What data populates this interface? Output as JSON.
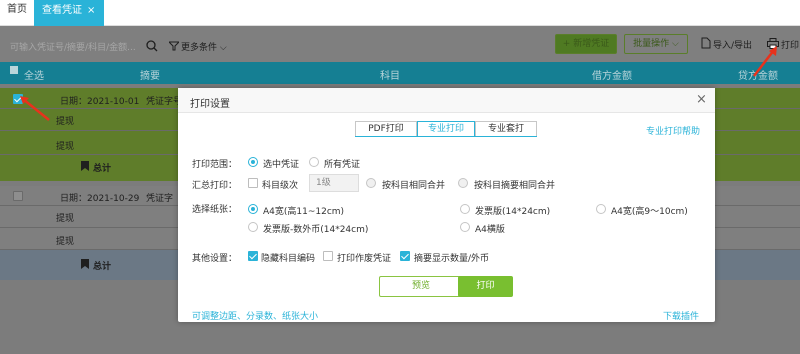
{
  "tabs": {
    "home": "首页",
    "active": "查看凭证",
    "active_close": "×"
  },
  "toolbar": {
    "search_placeholder": "可输入凭证号/摘要/科目/金额...",
    "more_conditions": "更多条件",
    "add_voucher": "+ 新增凭证",
    "batch_ops": "批量操作",
    "import_export": "导入/导出",
    "print": "打印"
  },
  "table": {
    "headers": {
      "select_all": "全选",
      "summary": "摘要",
      "subject": "科目",
      "debit": "借方金额",
      "credit": "贷方金额"
    },
    "groups": [
      {
        "date": "日期：2021-10-01",
        "voucher": "凭证字号",
        "rows": [
          "提现",
          "提现"
        ],
        "total": "总计",
        "selected": true
      },
      {
        "date": "日期：2021-10-29",
        "voucher": "凭证字",
        "rows": [
          "提现",
          "提现"
        ],
        "total": "总计",
        "selected": false
      }
    ]
  },
  "dialog": {
    "title": "打印设置",
    "close": "×",
    "tabs": [
      "PDF打印",
      "专业打印",
      "专业套打"
    ],
    "help_link": "专业打印帮助",
    "print_range": {
      "label": "打印范围：",
      "options": [
        "选中凭证",
        "所有凭证"
      ]
    },
    "summary_print": {
      "label": "汇总打印：",
      "subject_level": "科目级次",
      "level_value": "1级",
      "merge_subject": "按科目相同合并",
      "merge_subject_summary": "按科目摘要相同合并"
    },
    "paper": {
      "label": "选择纸张：",
      "options": [
        "A4宽(高11~12cm)",
        "发票版(14*24cm)",
        "A4宽(高9～10cm)",
        "发票版-数外币(14*24cm)",
        "A4横版"
      ]
    },
    "other": {
      "label": "其他设置：",
      "options": [
        "隐藏科目编码",
        "打印作废凭证",
        "摘要显示数量/外币"
      ]
    },
    "btn_preview": "预览",
    "btn_print": "打印",
    "footer_left": "可调整边距、分录数、纸张大小",
    "footer_right": "下载插件"
  },
  "colors": {
    "accent": "#2ab3d8",
    "green": "#79bf30",
    "header": "#157f93",
    "arrow": "#e8321c"
  }
}
